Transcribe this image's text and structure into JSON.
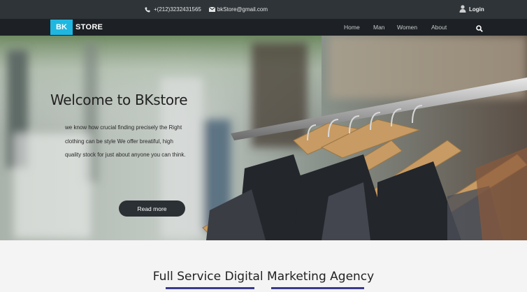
{
  "topbar": {
    "phone": "+(212)3232431565",
    "email": "bkStore@gmail.com",
    "login": "Login"
  },
  "navbar": {
    "logo_badge": "BK",
    "logo_text": "STORE",
    "links": [
      "Home",
      "Man",
      "Women",
      "About"
    ]
  },
  "hero": {
    "title": "Welcome to BKstore",
    "text": "we know how crucial finding precisely the Right clothing can be style We offer breatiful, high quality stock for just about anyone you can think.",
    "button": "Read more"
  },
  "section": {
    "title": "Full Service Digital Marketing Agency"
  },
  "colors": {
    "accent": "#1fb7e0",
    "topbar": "#2e3438",
    "navbar": "#1d2125",
    "underline": "#3a3a8c"
  },
  "icons": [
    "phone-icon",
    "envelope-icon",
    "user-icon",
    "search-icon"
  ]
}
